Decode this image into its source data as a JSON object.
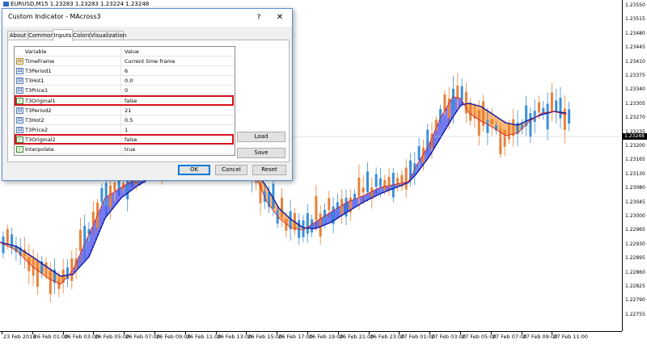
{
  "symbol": {
    "title": "EURUSD,M15  1.23283 1.23283 1.23224 1.23248"
  },
  "price_axis": {
    "labels": [
      "1.23550",
      "1.23515",
      "1.23480",
      "1.23445",
      "1.23410",
      "1.23375",
      "1.23340",
      "1.23305",
      "1.23270",
      "1.23235",
      "1.23200",
      "1.23165",
      "1.23130",
      "1.23080",
      "1.23045",
      "1.23000",
      "1.22965",
      "1.22930",
      "1.22895",
      "1.22860",
      "1.22825",
      "1.22790",
      "1.22755"
    ],
    "current": "1.23248"
  },
  "time_axis": {
    "labels": [
      "23 Feb 2018",
      "26 Feb 01:00",
      "26 Feb 03:00",
      "26 Feb 05:00",
      "26 Feb 07:00",
      "26 Feb 09:00",
      "26 Feb 11:00",
      "26 Feb 13:00",
      "26 Feb 15:00",
      "26 Feb 17:00",
      "26 Feb 19:00",
      "26 Feb 21:00",
      "26 Feb 23:00",
      "27 Feb 01:00",
      "27 Feb 03:00",
      "27 Feb 05:00",
      "27 Feb 07:00",
      "27 Feb 09:00",
      "27 Feb 11:00"
    ]
  },
  "colors": {
    "up_fill": "#1a22e6",
    "down_fill": "#ff8c1a",
    "candle_up": "#3b8fd9",
    "candle_down": "#e8813a",
    "highlight": "#d9121f"
  },
  "dialog": {
    "title": "Custom Indicator - MAcross3",
    "help": "?",
    "close": "✕",
    "tabs": [
      "About",
      "Common",
      "Inputs",
      "Colors",
      "Visualization"
    ],
    "active_tab": "Inputs",
    "grid": {
      "header": {
        "variable": "Variable",
        "value": "Value"
      },
      "rows": [
        {
          "name": "TimeFrame",
          "value": "Current time frame",
          "type": "str",
          "icon": "enum-icon"
        },
        {
          "name": "T3Period1",
          "value": "6",
          "type": "int",
          "icon": "int-icon"
        },
        {
          "name": "T3Hot1",
          "value": "0.0",
          "type": "int",
          "icon": "double-icon"
        },
        {
          "name": "T3Price1",
          "value": "0",
          "type": "int",
          "icon": "int-icon"
        },
        {
          "name": "T3Original1",
          "value": "false",
          "type": "bool",
          "icon": "bool-icon",
          "highlighted": true
        },
        {
          "name": "T3Period2",
          "value": "21",
          "type": "int",
          "icon": "int-icon"
        },
        {
          "name": "T3Hot2",
          "value": "0.5",
          "type": "int",
          "icon": "double-icon"
        },
        {
          "name": "T3Price2",
          "value": "1",
          "type": "int",
          "icon": "int-icon"
        },
        {
          "name": "T3Original2",
          "value": "false",
          "type": "bool",
          "icon": "bool-icon",
          "highlighted": true
        },
        {
          "name": "Interpolate",
          "value": "true",
          "type": "bool",
          "icon": "bool-icon"
        }
      ]
    },
    "buttons": {
      "load": "Load",
      "save": "Save",
      "ok": "OK",
      "cancel": "Cancel",
      "reset": "Reset"
    }
  }
}
